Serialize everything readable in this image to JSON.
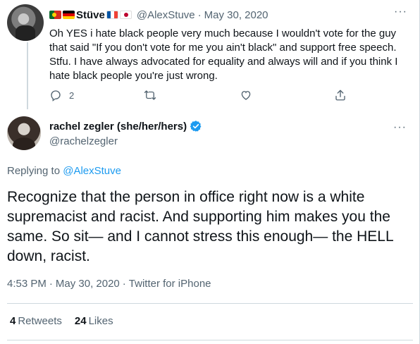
{
  "parent_tweet": {
    "display_name": "Stüve",
    "flags": [
      "portugal-flag",
      "germany-flag",
      "france-flag",
      "japan-flag"
    ],
    "handle": "@AlexStuve",
    "separator": "·",
    "date": "May 30, 2020",
    "more_label": "···",
    "text": "Oh YES i hate black people very much because I wouldn't vote for the guy that said \"If you don't vote for me you ain't black\" and support free speech. Stfu. I have always advocated for equality and always will and if you think I hate black people you're just wrong.",
    "reply_count": "2"
  },
  "main_tweet": {
    "display_name": "rachel zegler (she/her/hers)",
    "handle": "@rachelzegler",
    "more_label": "···",
    "replying_prefix": "Replying to ",
    "replying_to": "@AlexStuve",
    "text": "Recognize that the person in office right now is a white supremacist and racist. And supporting him makes you the same. So sit— and I cannot stress this enough— the HELL down, racist.",
    "time": "4:53 PM",
    "separator": "·",
    "date": "May 30, 2020",
    "client": "Twitter for iPhone",
    "retweets_count": "4",
    "retweets_label": "Retweets",
    "likes_count": "24",
    "likes_label": "Likes"
  },
  "colors": {
    "accent": "#1d9bf0",
    "text_primary": "#0f1419",
    "text_secondary": "#536471",
    "divider": "#cfd9de"
  }
}
